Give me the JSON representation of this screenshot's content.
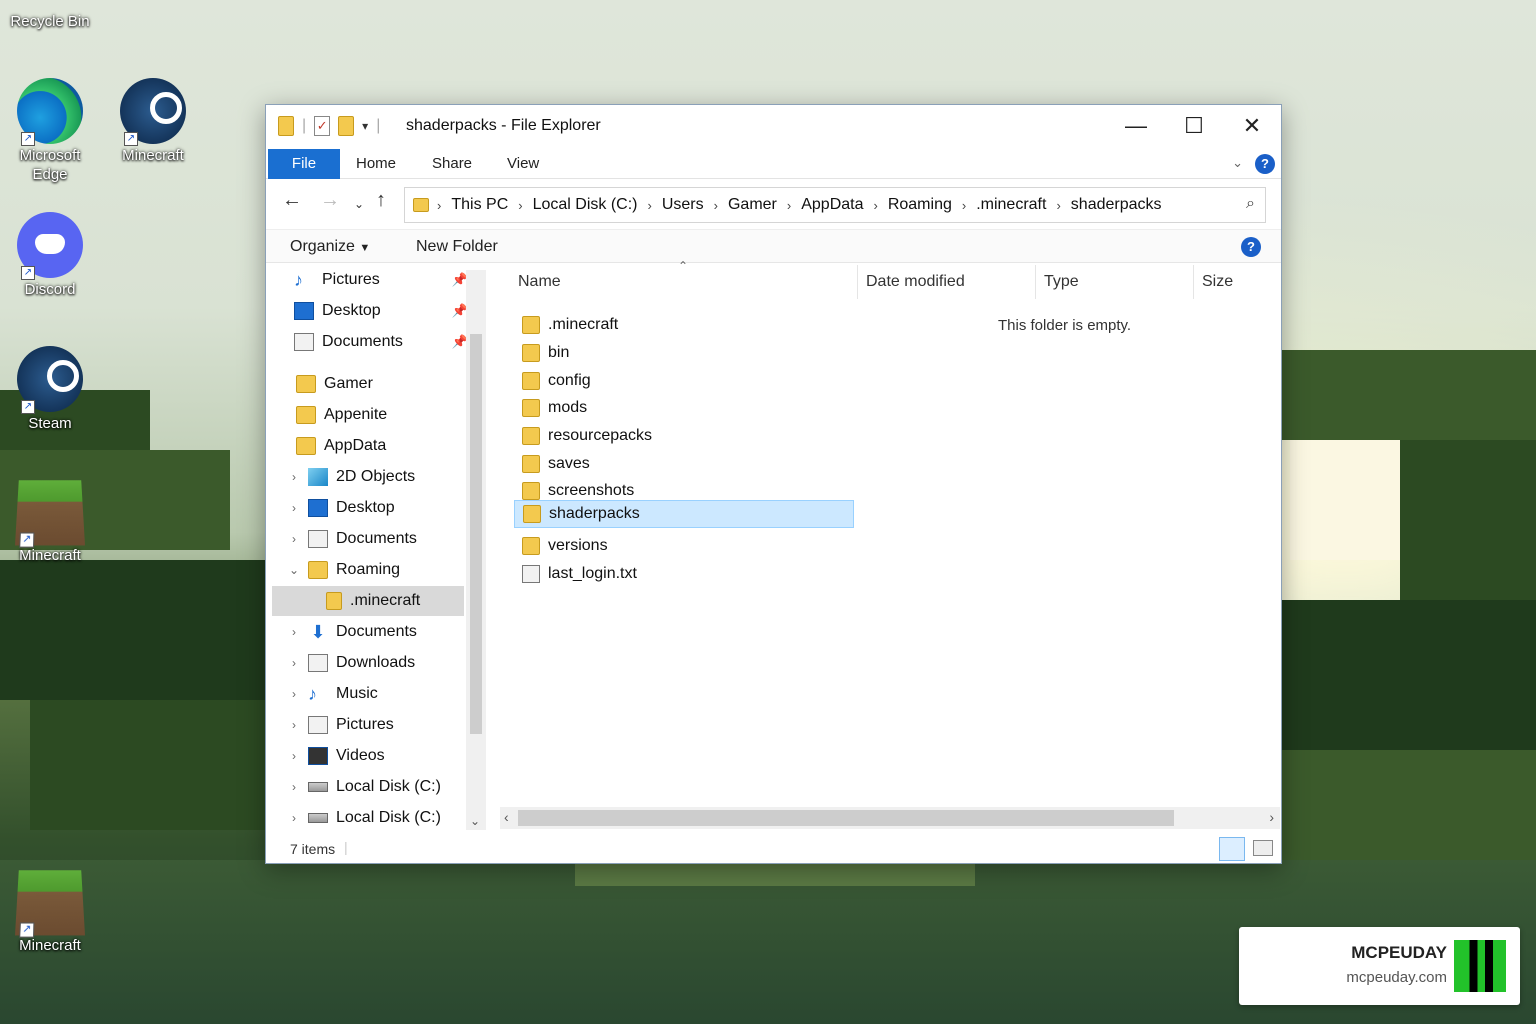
{
  "desktop": {
    "icons": [
      {
        "label": "Recycle Bin"
      },
      {
        "label": "Microsoft Edge"
      },
      {
        "label": "Minecraft"
      },
      {
        "label": "Discord"
      },
      {
        "label": "Steam"
      },
      {
        "label": "Minecraft"
      },
      {
        "label": "Minecraft"
      }
    ]
  },
  "window": {
    "title": "shaderpacks - File Explorer",
    "controls": {
      "minimize": "—",
      "maximize": "☐",
      "close": "✕"
    },
    "ribbon": {
      "file": "File",
      "home": "Home",
      "share": "Share",
      "view": "View"
    },
    "address": {
      "crumbs": [
        "This PC",
        "Local Disk (C:)",
        "Users",
        "Gamer",
        "AppData",
        "Roaming",
        ".minecraft",
        "shaderpacks"
      ]
    },
    "commands": {
      "organize": "Organize",
      "new_folder": "New Folder"
    },
    "nav_pane": [
      {
        "label": "Pictures",
        "icon": "music-icon"
      },
      {
        "label": "Desktop",
        "icon": "desktop-icon"
      },
      {
        "label": "Documents",
        "icon": "document-icon"
      },
      {
        "label": "Gamer",
        "icon": "folder-icon"
      },
      {
        "label": "Appenite",
        "icon": "folder-icon"
      },
      {
        "label": "AppData",
        "icon": "folder-icon"
      },
      {
        "label": "2D Objects",
        "icon": "cube-icon"
      },
      {
        "label": "Desktop",
        "icon": "desktop-icon"
      },
      {
        "label": "Documents",
        "icon": "document-icon"
      },
      {
        "label": "Roaming",
        "icon": "folder-icon"
      },
      {
        "label": ".minecraft",
        "icon": "folder-icon"
      },
      {
        "label": "Documents",
        "icon": "download-icon"
      },
      {
        "label": "Downloads",
        "icon": "document-icon"
      },
      {
        "label": "Music",
        "icon": "music-icon"
      },
      {
        "label": "Pictures",
        "icon": "pictures-icon"
      },
      {
        "label": "Videos",
        "icon": "videos-icon"
      },
      {
        "label": "Local Disk (C:)",
        "icon": "disk-icon"
      },
      {
        "label": "Local Disk (C:)",
        "icon": "disk-icon"
      }
    ],
    "columns": {
      "name": "Name",
      "date": "Date modified",
      "type": "Type",
      "size": "Size"
    },
    "files": [
      {
        "name": ".minecraft",
        "kind": "folder"
      },
      {
        "name": "bin",
        "kind": "folder"
      },
      {
        "name": "config",
        "kind": "folder"
      },
      {
        "name": "mods",
        "kind": "folder"
      },
      {
        "name": "resourcepacks",
        "kind": "folder"
      },
      {
        "name": "saves",
        "kind": "folder"
      },
      {
        "name": "screenshots",
        "kind": "folder"
      },
      {
        "name": "shaderpacks",
        "kind": "folder"
      },
      {
        "name": "versions",
        "kind": "folder"
      },
      {
        "name": "last_login.txt",
        "kind": "file"
      }
    ],
    "empty_message": "This folder is empty.",
    "status": "7 items"
  },
  "watermark": {
    "brand": "MCPEUDAY",
    "url": "mcpeuday.com"
  }
}
